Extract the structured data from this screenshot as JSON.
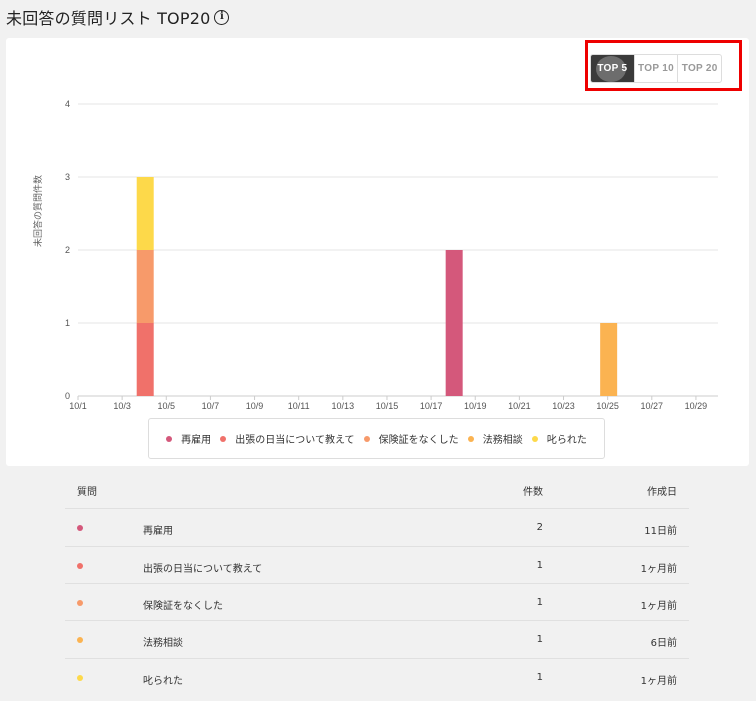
{
  "header": {
    "title": "未回答の質問リスト TOP20",
    "info_icon": "i"
  },
  "toggle": {
    "options": [
      "TOP 5",
      "TOP 10",
      "TOP 20"
    ],
    "selected": "TOP 5"
  },
  "colors": {
    "再雇用": "#d4587b",
    "出張の日当について教えて": "#f0716a",
    "保険証をなくした": "#f79a6a",
    "法務相談": "#fbb351",
    "叱られた": "#fdd94a"
  },
  "chart_data": {
    "type": "bar",
    "stacked": true,
    "ylabel": "未回答の質問件数",
    "ylim": [
      0,
      4
    ],
    "yticks": [
      0,
      1,
      2,
      3,
      4
    ],
    "x_range": [
      "10/1",
      "10/30"
    ],
    "xticks": [
      "10/1",
      "10/3",
      "10/5",
      "10/7",
      "10/9",
      "10/11",
      "10/13",
      "10/15",
      "10/17",
      "10/19",
      "10/21",
      "10/23",
      "10/25",
      "10/27",
      "10/29"
    ],
    "grid": true,
    "legend_position": "bottom",
    "series": [
      {
        "name": "再雇用",
        "points": [
          {
            "x": "10/18",
            "y": 2
          }
        ]
      },
      {
        "name": "出張の日当について教えて",
        "points": [
          {
            "x": "10/4",
            "y": 1
          }
        ]
      },
      {
        "name": "保険証をなくした",
        "points": [
          {
            "x": "10/4",
            "y": 1
          }
        ]
      },
      {
        "name": "法務相談",
        "points": [
          {
            "x": "10/25",
            "y": 1
          }
        ]
      },
      {
        "name": "叱られた",
        "points": [
          {
            "x": "10/4",
            "y": 1
          }
        ]
      }
    ]
  },
  "legend": [
    {
      "label": "再雇用",
      "color": "#d4587b"
    },
    {
      "label": "出張の日当について教えて",
      "color": "#f0716a"
    },
    {
      "label": "保険証をなくした",
      "color": "#f79a6a"
    },
    {
      "label": "法務相談",
      "color": "#fbb351"
    },
    {
      "label": "叱られた",
      "color": "#fdd94a"
    }
  ],
  "table": {
    "headers": {
      "question": "質問",
      "count": "件数",
      "created": "作成日"
    },
    "rows": [
      {
        "color": "#d4587b",
        "question": "再雇用",
        "count": "2",
        "created": "11日前"
      },
      {
        "color": "#f0716a",
        "question": "出張の日当について教えて",
        "count": "1",
        "created": "1ヶ月前"
      },
      {
        "color": "#f79a6a",
        "question": "保険証をなくした",
        "count": "1",
        "created": "1ヶ月前"
      },
      {
        "color": "#fbb351",
        "question": "法務相談",
        "count": "1",
        "created": "6日前"
      },
      {
        "color": "#fdd94a",
        "question": "叱られた",
        "count": "1",
        "created": "1ヶ月前"
      }
    ]
  }
}
